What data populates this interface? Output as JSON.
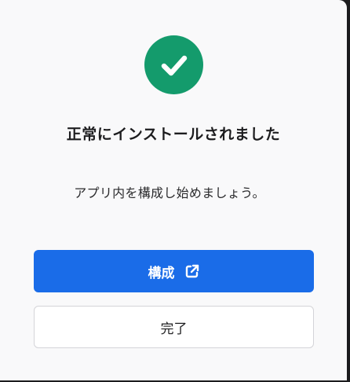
{
  "dialog": {
    "icon": "check-circle-icon",
    "title": "正常にインストールされました",
    "message": "アプリ内を構成し始めましょう。",
    "primary_button": {
      "label": "構成",
      "icon": "external-link-icon"
    },
    "secondary_button": {
      "label": "完了"
    }
  },
  "colors": {
    "success": "#149b6c",
    "primary": "#1a6ce8",
    "background": "#f9f9fa"
  }
}
